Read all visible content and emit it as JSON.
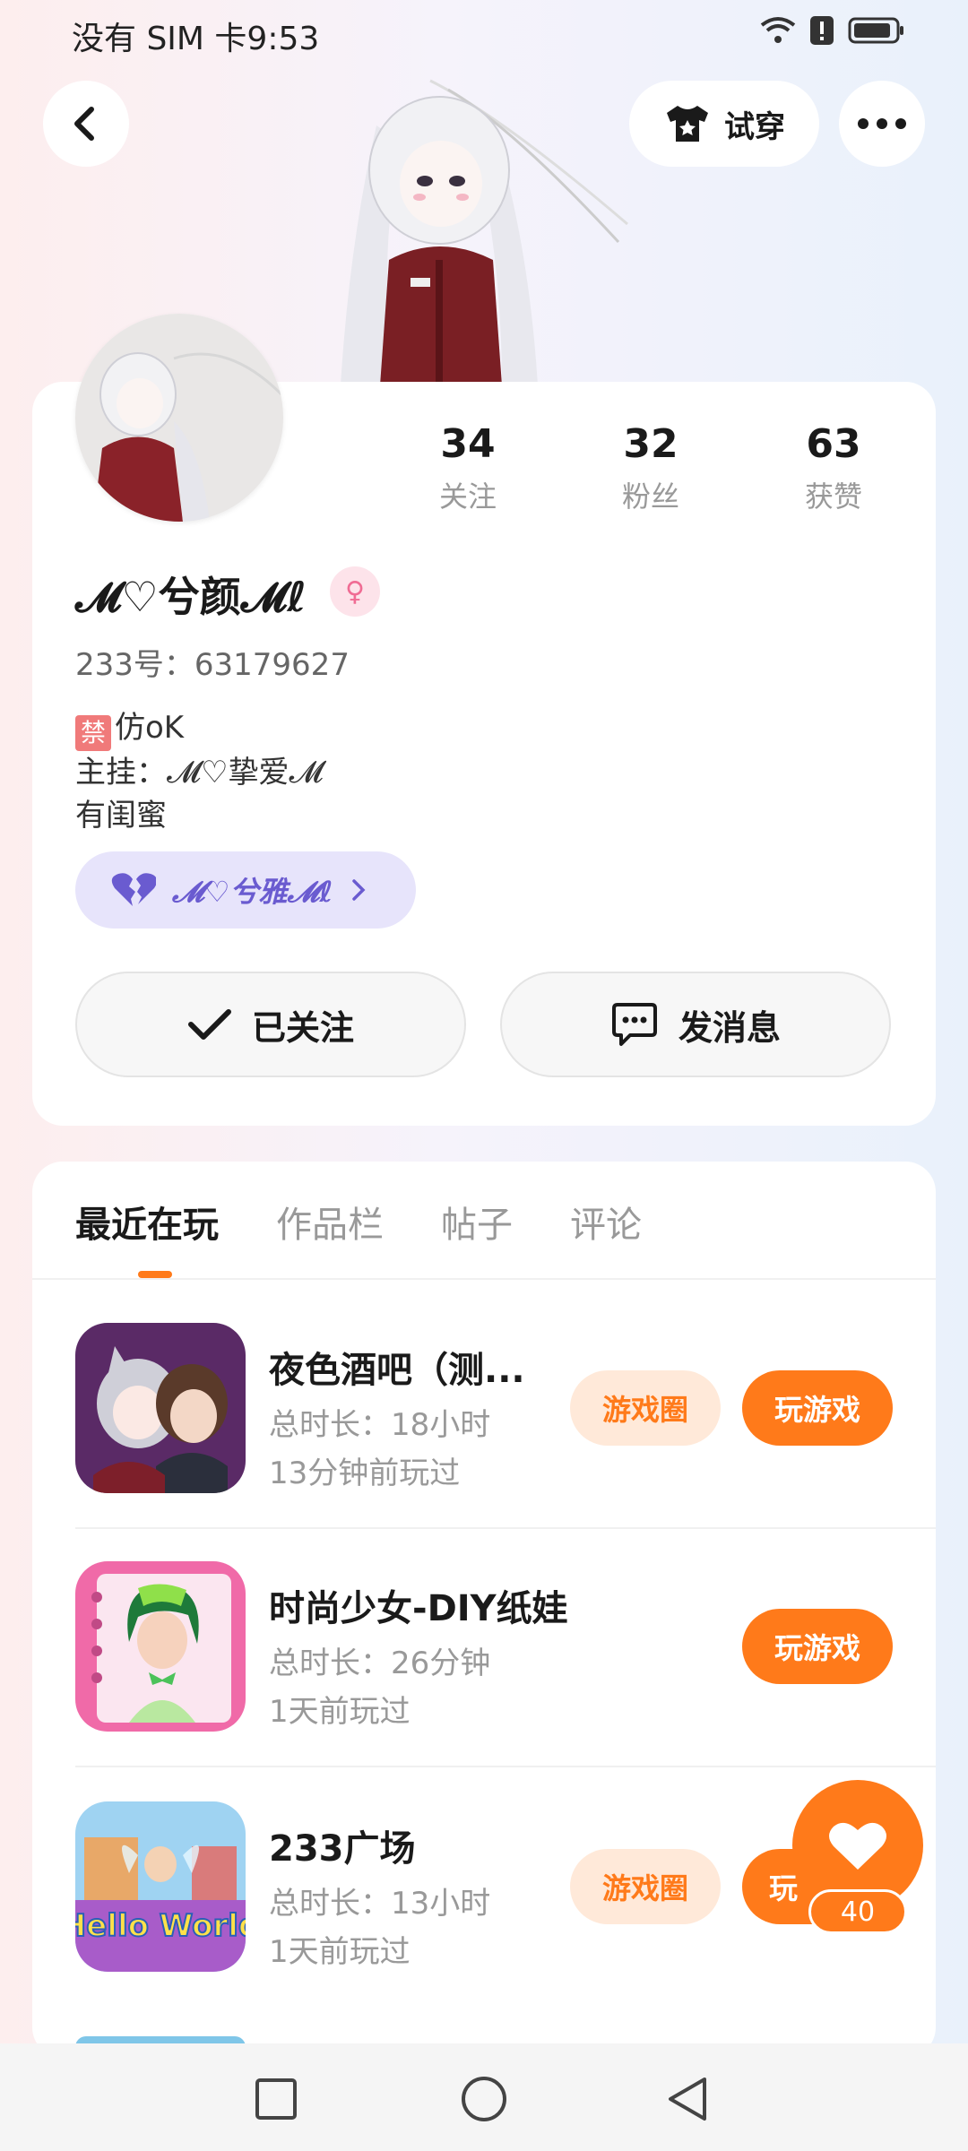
{
  "status_bar": {
    "carrier_time": "没有 SIM 卡9:53"
  },
  "header": {
    "try_on_label": "试穿"
  },
  "profile": {
    "stats": [
      {
        "num": "34",
        "label": "关注"
      },
      {
        "num": "32",
        "label": "粉丝"
      },
      {
        "num": "63",
        "label": "获赞"
      }
    ],
    "name": "𝓜♡兮颜𝓜ℓ",
    "id_line": "233号：63179627",
    "bio_ban_badge": "禁",
    "bio_line1_rest": "仿oK",
    "bio_line2": "主挂：𝓜♡挚爱𝓜",
    "bio_line3": "有闺蜜",
    "relation_label": "𝓜♡兮雅𝓜ℓ",
    "follow_label": "已关注",
    "message_label": "发消息"
  },
  "tabs": [
    "最近在玩",
    "作品栏",
    "帖子",
    "评论"
  ],
  "games": [
    {
      "title": "夜色酒吧（测...",
      "duration": "总时长：18小时",
      "last_played": "13分钟前玩过",
      "circle_label": "游戏圈",
      "play_label": "玩游戏"
    },
    {
      "title": "时尚少女-DIY纸娃",
      "duration": "总时长：26分钟",
      "last_played": "1天前玩过",
      "play_label": "玩游戏"
    },
    {
      "title": "233广场",
      "duration": "总时长：13小时",
      "last_played": "1天前玩过",
      "circle_label": "游戏圈",
      "play_label": "玩",
      "icon_text": "Hello World"
    }
  ],
  "like_float": {
    "count": "40"
  },
  "colors": {
    "accent": "#ff7a1a",
    "relation_bg": "#e7e4fb",
    "relation_text": "#6a5bd0"
  }
}
